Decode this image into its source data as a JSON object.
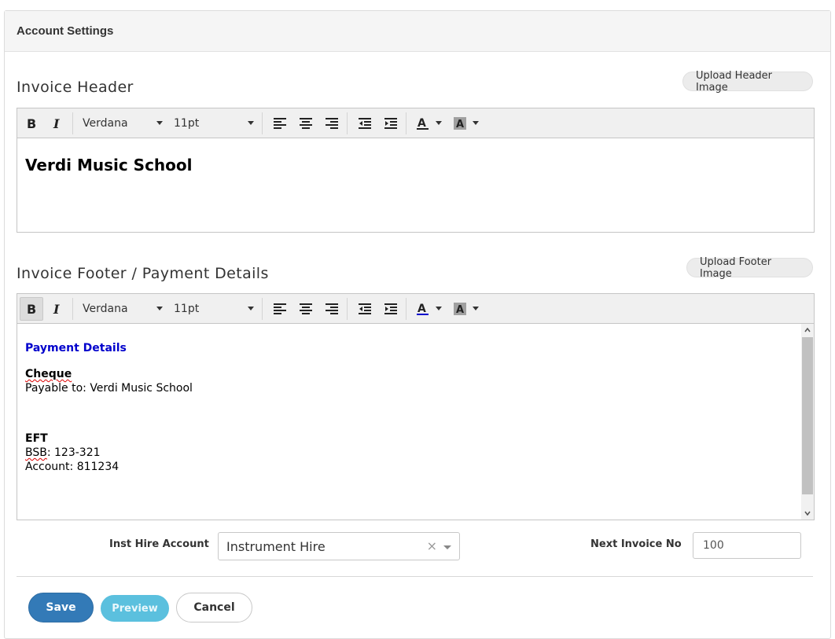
{
  "panel": {
    "title": "Account Settings"
  },
  "header_section": {
    "title": "Invoice Header",
    "upload_label": "Upload Header Image",
    "toolbar": {
      "font": "Verdana",
      "size": "11pt"
    },
    "content": {
      "heading": "Verdi Music School"
    }
  },
  "footer_section": {
    "title": "Invoice Footer / Payment Details",
    "upload_label": "Upload Footer Image",
    "toolbar": {
      "font": "Verdana",
      "size": "11pt"
    },
    "content": {
      "heading": "Payment Details",
      "cheque_title": "Cheque",
      "cheque_line": "Payable to: Verdi Music School",
      "eft_title": "EFT",
      "bsb_label": "BSB",
      "bsb_value": ": 123-321",
      "account_line": "Account: 811234"
    }
  },
  "form": {
    "inst_hire_label": "Inst Hire Account",
    "inst_hire_value": "Instrument Hire",
    "next_invoice_label": "Next Invoice No",
    "next_invoice_value": "100"
  },
  "actions": {
    "save": "Save",
    "preview": "Preview",
    "cancel": "Cancel"
  },
  "colors": {
    "accent": "#337ab7",
    "preview": "#5bc0de",
    "link_text": "#0000cc"
  },
  "icons": [
    "bold-icon",
    "italic-icon",
    "align-left-icon",
    "align-center-icon",
    "align-right-icon",
    "outdent-icon",
    "indent-icon",
    "font-color-icon",
    "highlight-color-icon",
    "clear-icon",
    "chevron-down-icon"
  ]
}
